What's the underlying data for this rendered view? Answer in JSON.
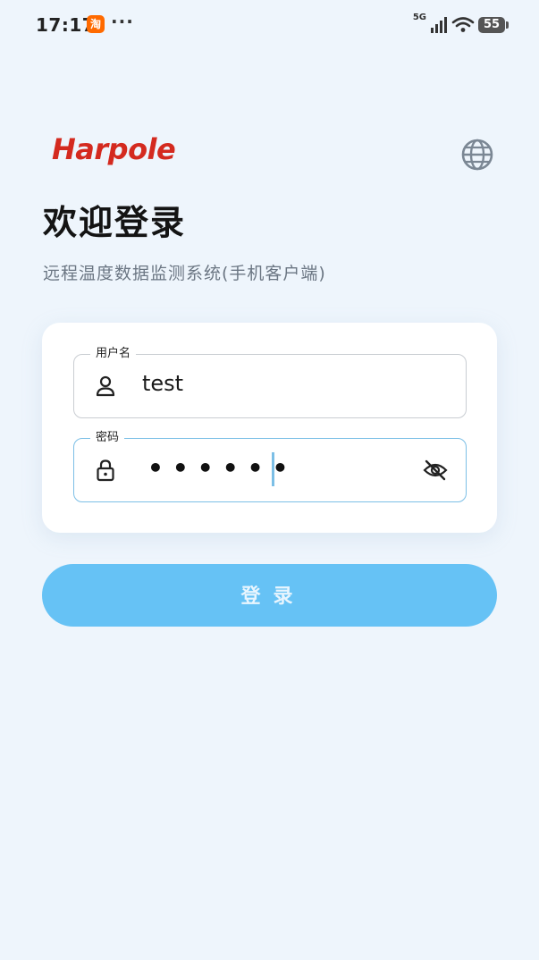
{
  "status_bar": {
    "time": "17:17",
    "app_badge": "淘",
    "more": "···",
    "network": "5G",
    "battery": "55"
  },
  "header": {
    "logo": "Harpole",
    "title": "欢迎登录",
    "subtitle": "远程温度数据监测系统(手机客户端)"
  },
  "form": {
    "username": {
      "label": "用户名",
      "value": "test",
      "icon": "user-icon"
    },
    "password": {
      "label": "密码",
      "masked_value": "••••••",
      "icon": "lock-icon",
      "toggle_icon": "eye-off-icon"
    }
  },
  "login_button": {
    "label": "登录"
  },
  "colors": {
    "brand": "#d42a1f",
    "primary": "#66c2f5",
    "focus_border": "#7cbfe6",
    "background": "#eef5fc"
  }
}
